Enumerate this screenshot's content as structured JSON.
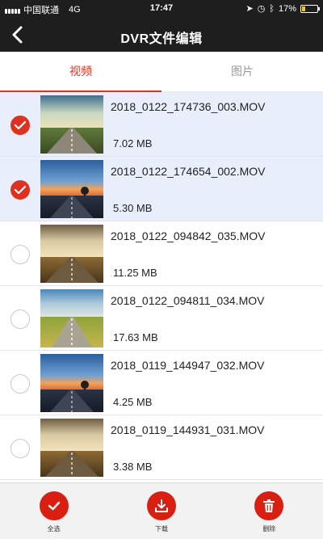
{
  "status_bar": {
    "carrier": "中国联通",
    "network": "4G",
    "time": "17:47",
    "battery": "17%"
  },
  "navbar": {
    "back_icon": "chevron-left-icon",
    "title": "DVR文件编辑"
  },
  "tabs": [
    {
      "label": "视频",
      "active": true
    },
    {
      "label": "图片",
      "active": false
    }
  ],
  "files": [
    {
      "name": "2018_0122_174736_003.MOV",
      "size": "7.02 MB",
      "selected": true
    },
    {
      "name": "2018_0122_174654_002.MOV",
      "size": "5.30 MB",
      "selected": true
    },
    {
      "name": "2018_0122_094842_035.MOV",
      "size": "11.25 MB",
      "selected": false
    },
    {
      "name": "2018_0122_094811_034.MOV",
      "size": "17.63 MB",
      "selected": false
    },
    {
      "name": "2018_0119_144947_032.MOV",
      "size": "4.25 MB",
      "selected": false
    },
    {
      "name": "2018_0119_144931_031.MOV",
      "size": "3.38 MB",
      "selected": false
    }
  ],
  "actions": {
    "select_all": {
      "label": "全选",
      "icon": "checkmark-icon"
    },
    "download": {
      "label": "下载",
      "icon": "download-icon"
    },
    "delete": {
      "label": "删除",
      "icon": "trash-icon"
    }
  },
  "colors": {
    "accent": "#e0311f",
    "bar": "#1e1e1e",
    "selected_row": "#e8eefa"
  }
}
